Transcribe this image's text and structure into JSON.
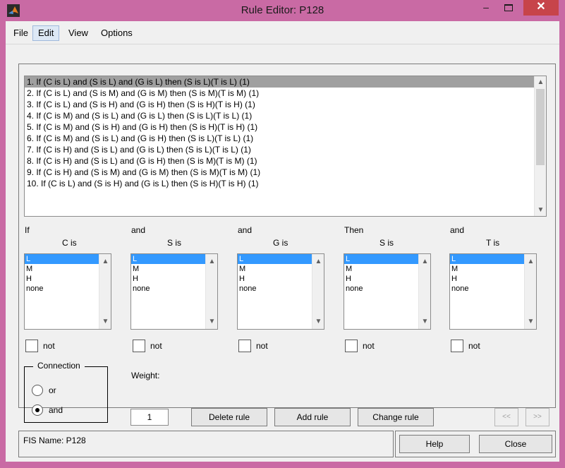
{
  "window": {
    "title": "Rule Editor: P128",
    "minimize_glyph": "–",
    "close_glyph": "✕"
  },
  "menu": [
    "File",
    "Edit",
    "View",
    "Options"
  ],
  "rules": [
    "1. If (C is L) and (S is L) and (G is L) then (S is L)(T is L) (1)",
    "2. If (C is L) and (S is M) and (G is M) then (S is M)(T is M) (1)",
    "3. If (C is L) and (S is H) and (G is H) then (S is H)(T is H) (1)",
    "4. If (C is M) and (S is L) and (G is L) then (S is L)(T is L) (1)",
    "5. If (C is M) and (S is H) and (G is H) then (S is H)(T is H) (1)",
    "6. If (C is M) and (S is L) and (G is H) then (S is L)(T is L) (1)",
    "7. If (C is H) and (S is L) and (G is L) then (S is L)(T is L) (1)",
    "8. If (C is H) and (S is L) and (G is H) then (S is M)(T is M) (1)",
    "9. If (C is H) and (S is M) and (G is M) then (S is M)(T is M) (1)",
    "10. If (C is L) and (S is H) and (G is L) then (S is H)(T is H) (1)"
  ],
  "columns": [
    {
      "head": "If",
      "var": "C is",
      "options": [
        "L",
        "M",
        "H",
        "none"
      ],
      "not": "not"
    },
    {
      "head": "and",
      "var": "S is",
      "options": [
        "L",
        "M",
        "H",
        "none"
      ],
      "not": "not"
    },
    {
      "head": "and",
      "var": "G is",
      "options": [
        "L",
        "M",
        "H",
        "none"
      ],
      "not": "not"
    },
    {
      "head": "Then",
      "var": "S is",
      "options": [
        "L",
        "M",
        "H",
        "none"
      ],
      "not": "not"
    },
    {
      "head": "and",
      "var": "T is",
      "options": [
        "L",
        "M",
        "H",
        "none"
      ],
      "not": "not"
    }
  ],
  "connection": {
    "title": "Connection",
    "or": "or",
    "and": "and",
    "selected": "and"
  },
  "weight": {
    "label": "Weight:",
    "value": "1"
  },
  "buttons": {
    "delete": "Delete rule",
    "add": "Add rule",
    "change": "Change rule",
    "prev": "<<",
    "next": ">>",
    "help": "Help",
    "close": "Close"
  },
  "status": "FIS Name: P128"
}
